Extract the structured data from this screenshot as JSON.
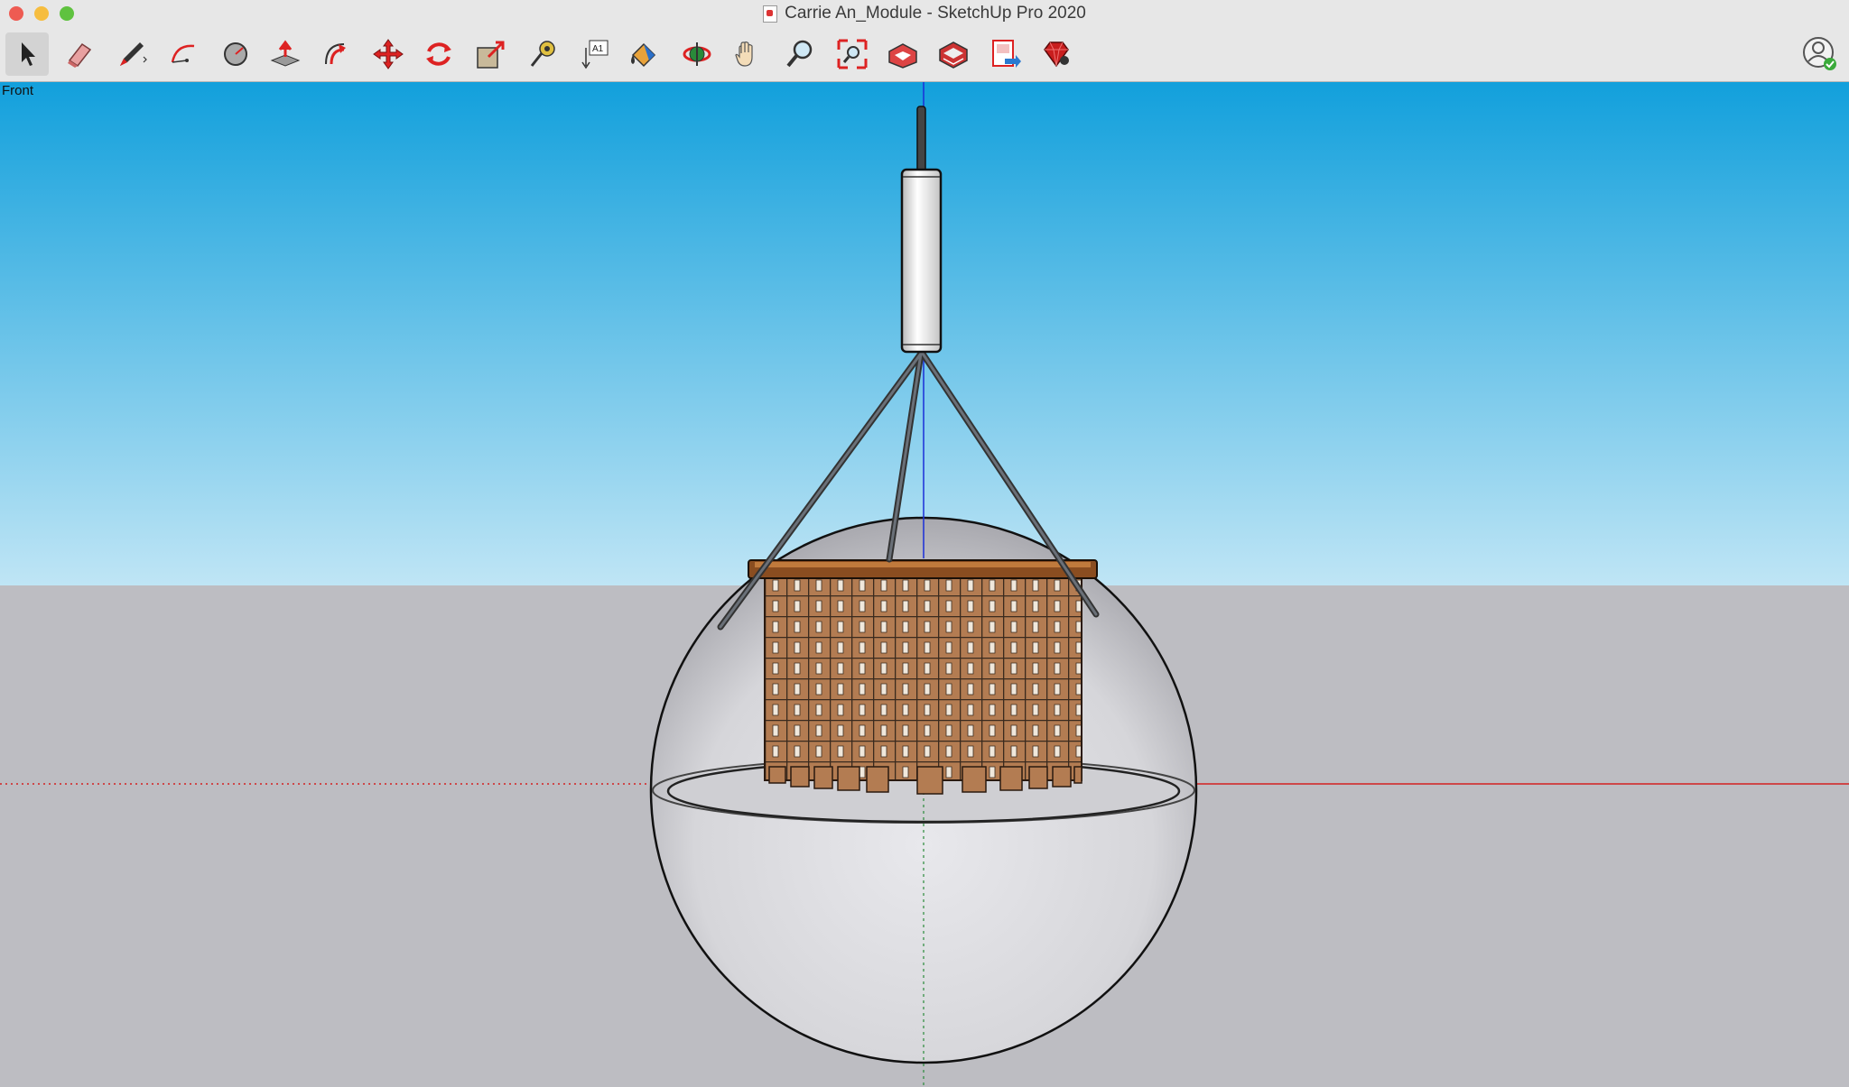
{
  "window": {
    "title": "Carrie An_Module - SketchUp Pro 2020",
    "traffic_colors": [
      "#ee5b52",
      "#f6bd3f",
      "#5fc23f"
    ]
  },
  "toolbar": {
    "tools": [
      {
        "name": "select-tool",
        "icon": "arrow-cursor-icon",
        "active": true
      },
      {
        "name": "eraser-tool",
        "icon": "eraser-icon"
      },
      {
        "name": "line-tool",
        "icon": "pencil-icon"
      },
      {
        "name": "arc-tool",
        "icon": "arc-icon"
      },
      {
        "name": "shapes-tool",
        "icon": "circle-icon"
      },
      {
        "name": "push-pull-tool",
        "icon": "push-pull-icon"
      },
      {
        "name": "offset-tool",
        "icon": "offset-icon"
      },
      {
        "name": "move-tool",
        "icon": "move-icon"
      },
      {
        "name": "rotate-tool",
        "icon": "rotate-icon"
      },
      {
        "name": "scale-tool",
        "icon": "scale-icon"
      },
      {
        "name": "tape-measure-tool",
        "icon": "tape-measure-icon"
      },
      {
        "name": "text-tool",
        "icon": "text-icon"
      },
      {
        "name": "paint-bucket-tool",
        "icon": "paint-bucket-icon"
      },
      {
        "name": "orbit-tool",
        "icon": "orbit-icon"
      },
      {
        "name": "pan-tool",
        "icon": "hand-icon"
      },
      {
        "name": "zoom-tool",
        "icon": "magnifier-icon"
      },
      {
        "name": "zoom-extents-tool",
        "icon": "zoom-extents-icon"
      },
      {
        "name": "3d-warehouse-tool",
        "icon": "warehouse-icon"
      },
      {
        "name": "extension-warehouse-tool",
        "icon": "extension-warehouse-icon"
      },
      {
        "name": "send-to-layout-tool",
        "icon": "layout-icon"
      },
      {
        "name": "extension-manager-tool",
        "icon": "ruby-icon"
      }
    ],
    "text_tool_label": "A1"
  },
  "viewport": {
    "view_label": "Front",
    "sky_top": "#12a0dc",
    "sky_bottom": "#bfe5f5",
    "ground": "#bdbdc2",
    "axis_red": "#d42020",
    "axis_blue": "#1a2fd8",
    "axis_green": "#2a8a3a",
    "wood": "#b37c52"
  }
}
